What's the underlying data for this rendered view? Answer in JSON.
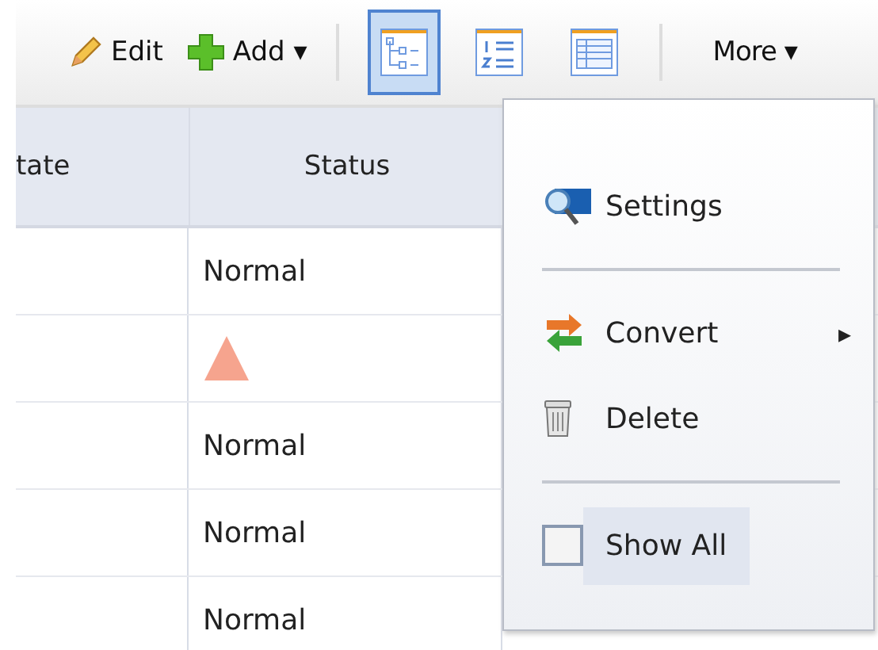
{
  "toolbar": {
    "edit": "Edit",
    "add": "Add ▾",
    "views": [
      {
        "kind": "tree",
        "selected": true
      },
      {
        "kind": "list",
        "selected": false
      },
      {
        "kind": "table",
        "selected": false
      }
    ],
    "more": "More ▾"
  },
  "table": {
    "columns": [
      "tate",
      "Status"
    ],
    "rows": [
      {
        "kind": "text",
        "status": "Normal"
      },
      {
        "kind": "warning"
      },
      {
        "kind": "text",
        "status": "Normal"
      },
      {
        "kind": "text",
        "status": "Normal"
      },
      {
        "kind": "text",
        "status": "Normal"
      }
    ]
  },
  "menu": {
    "items": [
      {
        "kind": "settings",
        "label": "Settings"
      },
      {
        "kind": "separator"
      },
      {
        "kind": "convert",
        "label": "Convert",
        "submenu": "▸"
      },
      {
        "kind": "delete",
        "label": "Delete"
      },
      {
        "kind": "separator"
      },
      {
        "kind": "checkbox",
        "label": "Show All",
        "checked": false,
        "selected": true
      }
    ]
  }
}
